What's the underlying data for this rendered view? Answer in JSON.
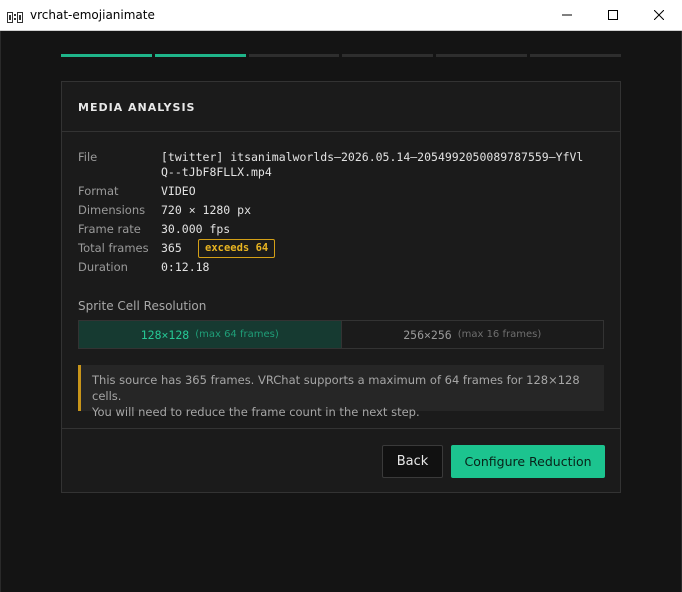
{
  "window": {
    "title": "vrchat-emojianimate",
    "buttons": {
      "minimize": "minimize-icon",
      "maximize": "maximize-icon",
      "close": "close-icon"
    }
  },
  "progress": {
    "total_steps": 6,
    "completed_steps": 2,
    "accent": "#1fb58a"
  },
  "card": {
    "title": "MEDIA ANALYSIS",
    "fields": {
      "file_label": "File",
      "file_line1": "[twitter] itsanimalworlds—2026.05.14—2054992050089787559—YfVl",
      "file_line2": "Q--tJbF8FLLX.mp4",
      "format_label": "Format",
      "format_value": "VIDEO",
      "dimensions_label": "Dimensions",
      "dimensions_value": "720 × 1280 px",
      "framerate_label": "Frame rate",
      "framerate_value": "30.000 fps",
      "total_frames_label": "Total frames",
      "total_frames_value": "365",
      "total_frames_badge": "exceeds 64",
      "duration_label": "Duration",
      "duration_value": "0:12.18"
    },
    "resolution": {
      "label": "Sprite Cell Resolution",
      "options": [
        {
          "value": "128×128",
          "note": "(max 64 frames)",
          "selected": true
        },
        {
          "value": "256×256",
          "note": "(max 16 frames)",
          "selected": false
        }
      ]
    },
    "warning": {
      "line1": "This source has 365 frames. VRChat supports a maximum of 64 frames for 128×128 cells.",
      "line2": "You will need to reduce the frame count in the next step.",
      "color": "#c8951a"
    },
    "footer": {
      "back_label": "Back",
      "primary_label": "Configure Reduction",
      "primary_color": "#1cc48f"
    }
  }
}
